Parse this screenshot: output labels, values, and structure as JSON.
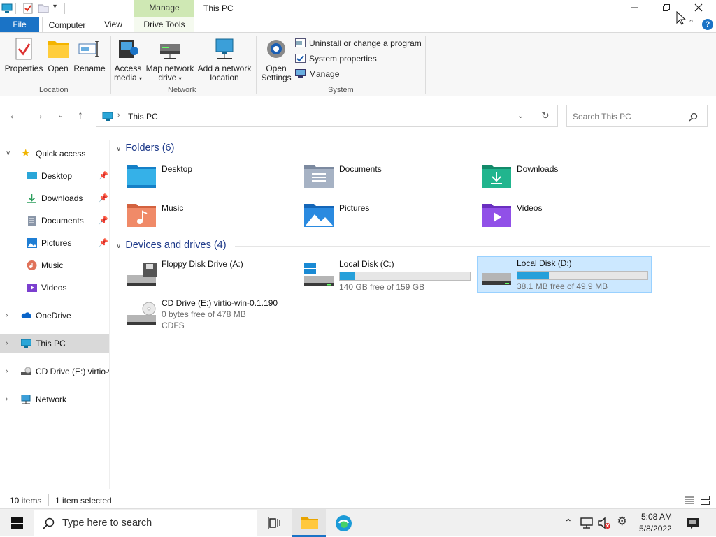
{
  "window": {
    "title": "This PC",
    "contextual_tab_header": "Manage"
  },
  "tabs": {
    "file": "File",
    "computer": "Computer",
    "view": "View",
    "drive_tools": "Drive Tools"
  },
  "ribbon": {
    "location": {
      "label": "Location",
      "properties": "Properties",
      "open": "Open",
      "rename": "Rename"
    },
    "network": {
      "label": "Network",
      "access_media_1": "Access",
      "access_media_2": "media",
      "map_drive_1": "Map network",
      "map_drive_2": "drive",
      "add_location_1": "Add a network",
      "add_location_2": "location"
    },
    "system": {
      "label": "System",
      "open_settings_1": "Open",
      "open_settings_2": "Settings",
      "uninstall": "Uninstall or change a program",
      "system_properties": "System properties",
      "manage": "Manage"
    }
  },
  "address": {
    "path": "This PC",
    "search_placeholder": "Search This PC"
  },
  "nav_pane": {
    "quick_access": "Quick access",
    "items": [
      {
        "label": "Desktop",
        "icon": "desktop-icon"
      },
      {
        "label": "Downloads",
        "icon": "downloads-icon"
      },
      {
        "label": "Documents",
        "icon": "documents-icon"
      },
      {
        "label": "Pictures",
        "icon": "pictures-icon"
      },
      {
        "label": "Music",
        "icon": "music-icon"
      },
      {
        "label": "Videos",
        "icon": "videos-icon"
      }
    ],
    "onedrive": "OneDrive",
    "this_pc": "This PC",
    "cd_drive": "CD Drive (E:) virtio-w",
    "network": "Network"
  },
  "folders": {
    "header": "Folders (6)",
    "items": [
      {
        "label": "Desktop"
      },
      {
        "label": "Documents"
      },
      {
        "label": "Downloads"
      },
      {
        "label": "Music"
      },
      {
        "label": "Pictures"
      },
      {
        "label": "Videos"
      }
    ]
  },
  "drives": {
    "header": "Devices and drives (4)",
    "floppy": {
      "name": "Floppy Disk Drive (A:)"
    },
    "c": {
      "name": "Local Disk (C:)",
      "free": "140 GB free of 159 GB",
      "used_fraction": 0.12
    },
    "d": {
      "name": "Local Disk (D:)",
      "free": "38.1 MB free of 49.9 MB",
      "used_fraction": 0.24
    },
    "e": {
      "name": "CD Drive (E:) virtio-win-0.1.190",
      "free": "0 bytes free of 478 MB",
      "fs": "CDFS"
    }
  },
  "status": {
    "items": "10 items",
    "selected": "1 item selected"
  },
  "taskbar": {
    "search_placeholder": "Type here to search",
    "time": "5:08 AM",
    "date": "5/8/2022"
  },
  "colors": {
    "accent": "#1a73c6",
    "selection": "#cce8ff",
    "drive_bar": "#26a0da",
    "group_header": "#1e3a8a"
  }
}
